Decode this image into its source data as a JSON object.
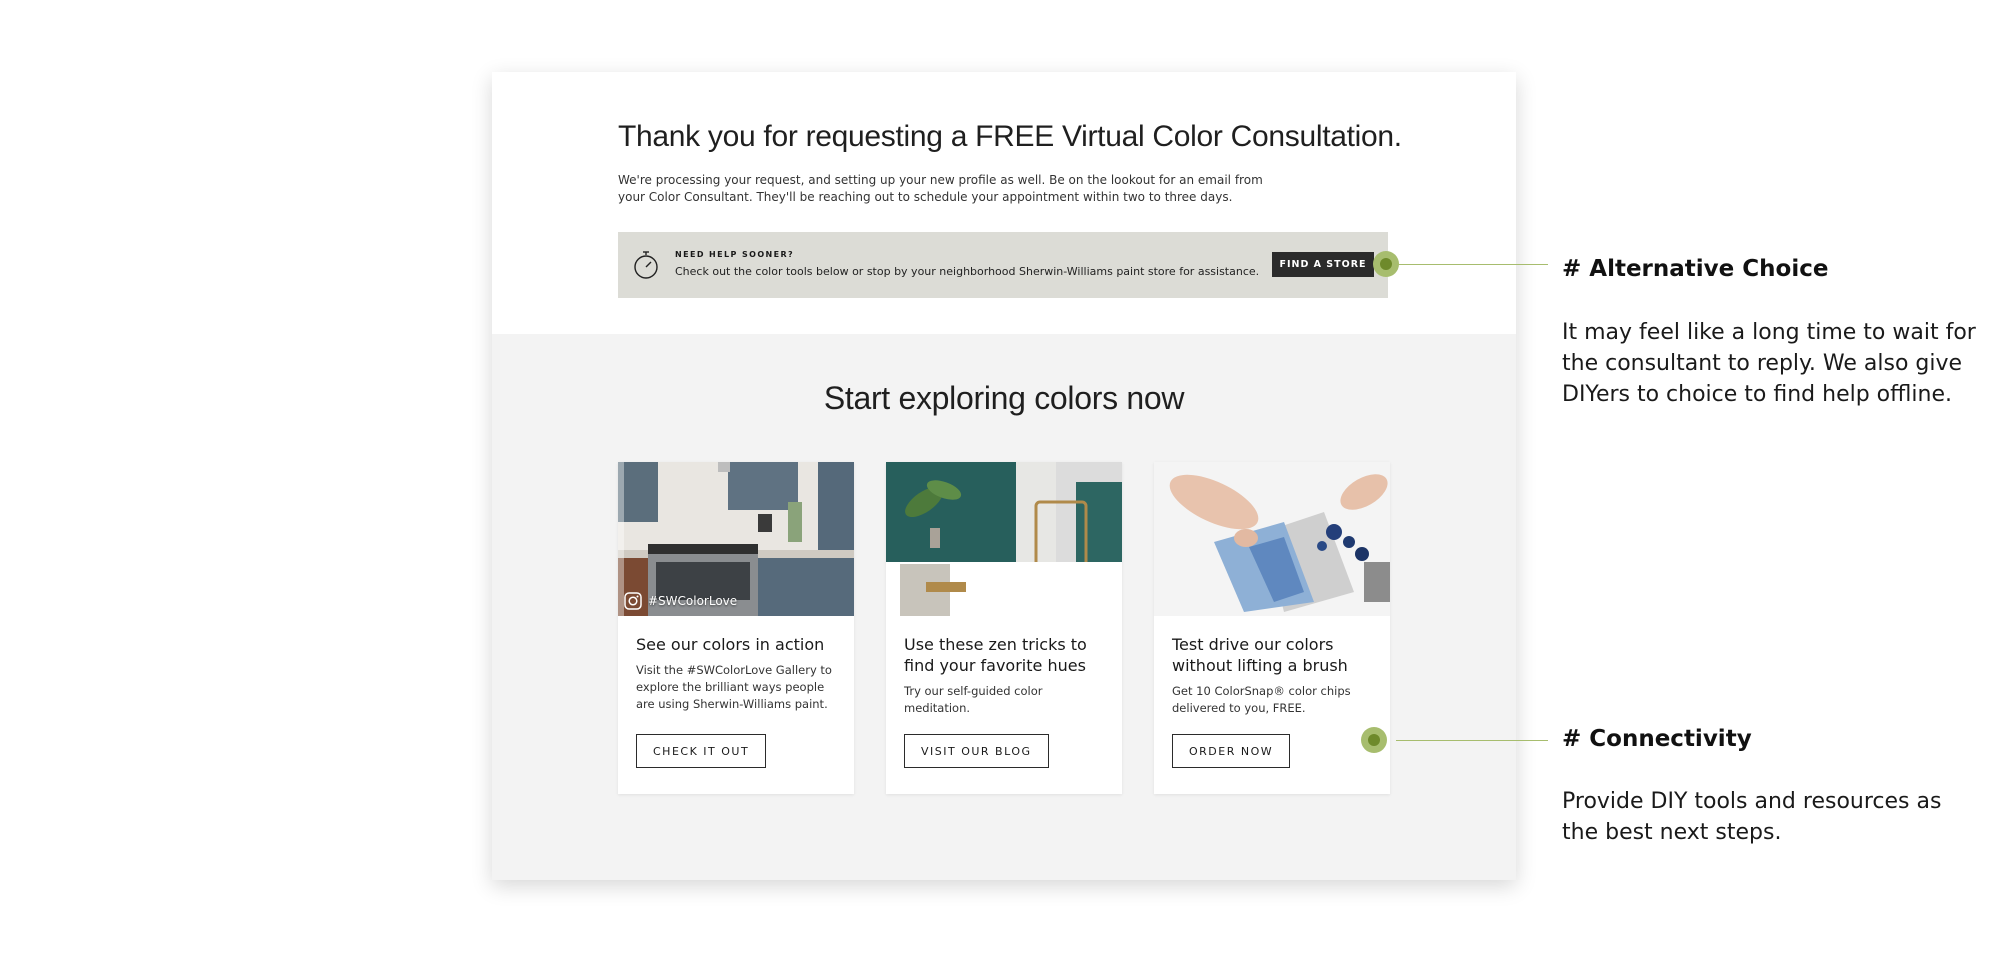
{
  "confirmation": {
    "title": "Thank you for requesting a FREE Virtual Color Consultation.",
    "intro": "We're processing your request, and setting up your new profile as well. Be on the lookout for an email from your Color Consultant. They'll be reaching out to schedule your appointment within two to three days."
  },
  "help_banner": {
    "icon": "stopwatch-icon",
    "label": "NEED HELP SOONER?",
    "text": "Check out the color tools below or stop by your neighborhood Sherwin-Williams paint store for assistance.",
    "button": "FIND A STORE"
  },
  "explore": {
    "heading": "Start exploring colors now",
    "cards": [
      {
        "image": "kitchen-photo",
        "tag": "#SWColorLove",
        "title": "See our colors in action",
        "desc": "Visit the #SWColorLove Gallery to explore the brilliant ways people are using Sherwin-Williams paint.",
        "button": "CHECK IT OUT"
      },
      {
        "image": "bathroom-photo",
        "title": "Use these zen tricks to find your favorite hues",
        "desc": "Try our self-guided color meditation.",
        "button": "VISIT OUR BLOG"
      },
      {
        "image": "color-chips-photo",
        "title": "Test drive our colors without lifting a brush",
        "desc": "Get 10 ColorSnap® color chips delivered to you, FREE.",
        "button": "ORDER NOW"
      }
    ]
  },
  "annotations": [
    {
      "heading": "# Alternative Choice",
      "body": "It may feel like a long time to wait for the consultant to reply. We also give DIYers to choice to find help offline."
    },
    {
      "heading": "# Connectivity",
      "body": "Provide DIY tools and resources as the best next steps."
    }
  ],
  "colors": {
    "accent_green": "#a7bd6e",
    "banner_bg": "#dcdcd6",
    "dark_button": "#2b2b2b",
    "section_bg": "#f3f3f3"
  }
}
